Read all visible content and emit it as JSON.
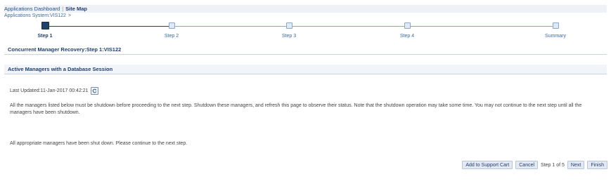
{
  "header": {
    "dashboard_link": "Applications Dashboard",
    "separator": "|",
    "sitemap_link": "Site Map"
  },
  "breadcrumb": {
    "label": "Applications System:VIS122",
    "arrow": ">"
  },
  "train": {
    "steps": [
      {
        "label": "Step 1",
        "state": "current"
      },
      {
        "label": "Step 2",
        "state": "pending"
      },
      {
        "label": "Step 3",
        "state": "pending"
      },
      {
        "label": "Step 4",
        "state": "pending"
      },
      {
        "label": "Summary",
        "state": "pending"
      }
    ]
  },
  "page": {
    "title": "Concurrent Manager Recovery:Step 1:VIS122"
  },
  "section": {
    "title": "Active Managers with a Database Session",
    "last_updated": "Last Updated:11-Jan-2017 00:42:21",
    "info": "All the managers listed below must be shutdown before proceeding to the next step. Shutdown these managers, and refresh this page to observe their status. Note that the shutdown operation may take some time. You may not continue to the next step until all the managers have been shutdown.",
    "status": "All appropriate managers have been shut down. Please continue to the next step."
  },
  "footer": {
    "add_to_cart": "Add to Support Cart",
    "cancel": "Cancel",
    "step_indicator": "Step 1 of 5",
    "next": "Next",
    "finish": "Finish"
  },
  "icons": {
    "refresh": "refresh-icon"
  },
  "colors": {
    "accent": "#1f3f6f",
    "link": "#3a6aa5",
    "button_bg": "#e3e9f2"
  }
}
